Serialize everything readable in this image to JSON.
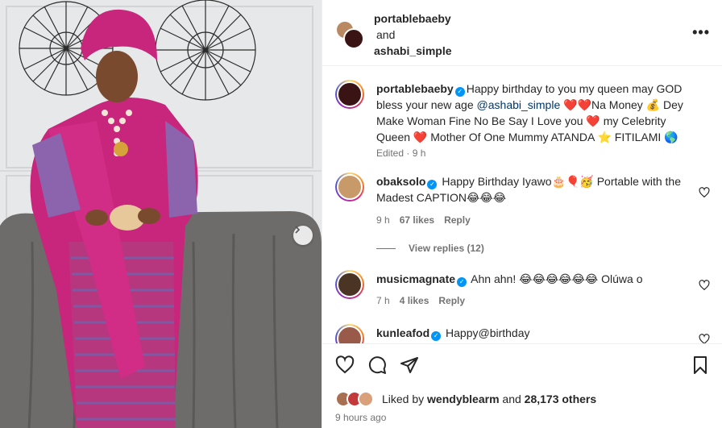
{
  "header": {
    "user1": "portablebaeby",
    "joiner": "and",
    "user2": "ashabi_simple",
    "more_icon": "more-horizontal-icon"
  },
  "caption": {
    "username": "portablebaeby",
    "text_1": "Happy birthday to you my queen may GOD bless your new age ",
    "mention": "@ashabi_simple",
    "text_2": " ❤️❤️Na Money 💰 Dey Make Woman Fine No Be Say I Love you ❤️ my Celebrity Queen ❤️ Mother Of One Mummy ATANDA ⭐ FITILAMI 🌎",
    "edited": "Edited · 9 h"
  },
  "comments": [
    {
      "username": "obaksolo",
      "text": "Happy Birthday Iyawo🎂🎈🥳 Portable with the Madest CAPTION😂😂😂",
      "age": "9 h",
      "likes": "67 likes",
      "reply": "Reply"
    },
    {
      "username": "musicmagnate",
      "text": "Ahn ahn! 😂😂😂😂😂😂 Olúwa o",
      "age": "7 h",
      "likes": "4 likes",
      "reply": "Reply"
    },
    {
      "username": "kunleafod",
      "text": "Happy@birthday"
    }
  ],
  "view_replies": "View replies (12)",
  "footer": {
    "liked_prefix": "Liked by ",
    "liked_user": "wendyblearm",
    "liked_suffix": " and ",
    "liked_count": "28,173 others",
    "time": "9 hours ago"
  },
  "colors": {
    "accent": "#0095f6",
    "mention": "#00376b",
    "outfit_pink": "#c8257d",
    "meta_gray": "#737373"
  }
}
